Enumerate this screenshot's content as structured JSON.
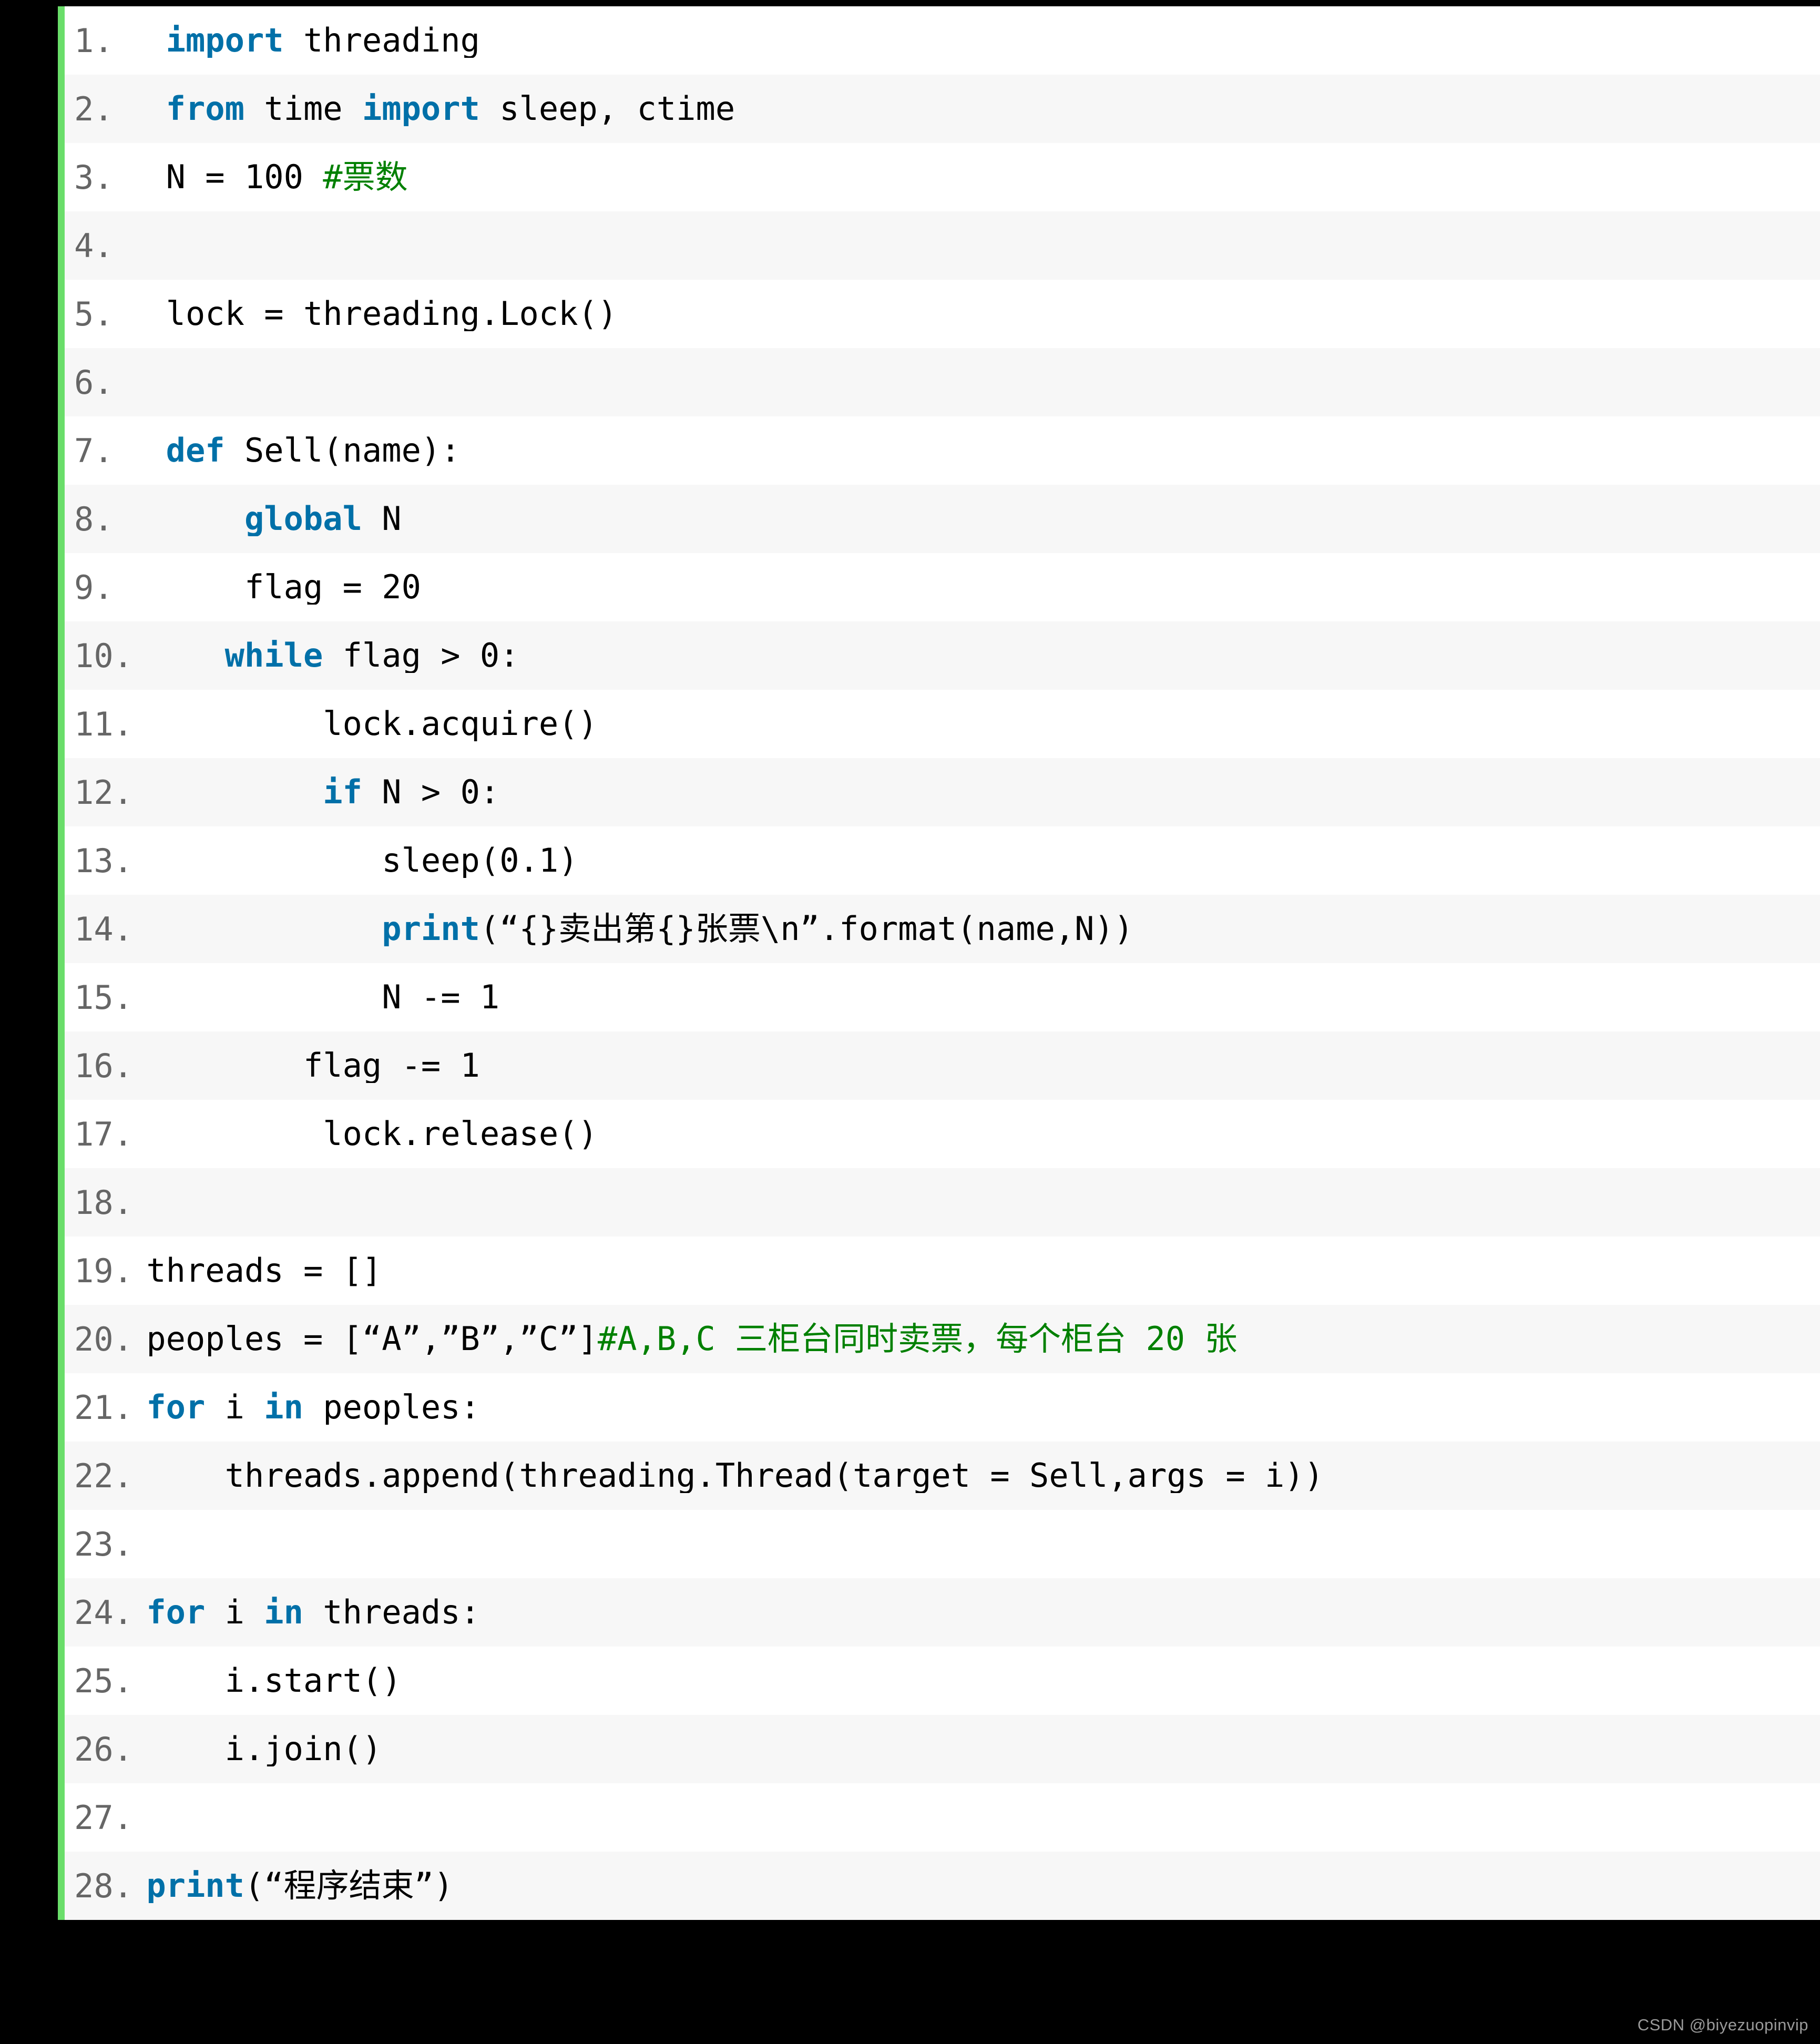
{
  "colors": {
    "page_background": "#000000",
    "code_background": "#ffffff",
    "code_background_alt": "#f7f7f7",
    "accent_bar": "#6ade6a",
    "keyword": "#0070a8",
    "comment": "#008000",
    "line_number": "#666666",
    "code_text": "#000000",
    "watermark": "#9a9a9a"
  },
  "code_block": {
    "language": "python",
    "lines": [
      {
        "n": "1.",
        "segments": [
          {
            "t": "  ",
            "c": "plain"
          },
          {
            "t": "import",
            "c": "kw"
          },
          {
            "t": " threading",
            "c": "plain"
          }
        ]
      },
      {
        "n": "2.",
        "segments": [
          {
            "t": "  ",
            "c": "plain"
          },
          {
            "t": "from",
            "c": "kw"
          },
          {
            "t": " time ",
            "c": "plain"
          },
          {
            "t": "import",
            "c": "kw"
          },
          {
            "t": " sleep, ctime",
            "c": "plain"
          }
        ]
      },
      {
        "n": "3.",
        "segments": [
          {
            "t": "  N = 100 ",
            "c": "plain"
          },
          {
            "t": "#票数",
            "c": "cmt"
          }
        ]
      },
      {
        "n": "4.",
        "segments": []
      },
      {
        "n": "5.",
        "segments": [
          {
            "t": "  lock = threading.Lock()",
            "c": "plain"
          }
        ]
      },
      {
        "n": "6.",
        "segments": []
      },
      {
        "n": "7.",
        "segments": [
          {
            "t": "  ",
            "c": "plain"
          },
          {
            "t": "def",
            "c": "kw"
          },
          {
            "t": " Sell(name):",
            "c": "plain"
          }
        ]
      },
      {
        "n": "8.",
        "segments": [
          {
            "t": "      ",
            "c": "plain"
          },
          {
            "t": "global",
            "c": "kw"
          },
          {
            "t": " N",
            "c": "plain"
          }
        ]
      },
      {
        "n": "9.",
        "segments": [
          {
            "t": "      flag = 20",
            "c": "plain"
          }
        ]
      },
      {
        "n": "10.",
        "segments": [
          {
            "t": "     ",
            "c": "plain"
          },
          {
            "t": "while",
            "c": "kw"
          },
          {
            "t": " flag > 0:",
            "c": "plain"
          }
        ]
      },
      {
        "n": "11.",
        "segments": [
          {
            "t": "          lock.acquire()",
            "c": "plain"
          }
        ]
      },
      {
        "n": "12.",
        "segments": [
          {
            "t": "          ",
            "c": "plain"
          },
          {
            "t": "if",
            "c": "kw"
          },
          {
            "t": " N > 0:",
            "c": "plain"
          }
        ]
      },
      {
        "n": "13.",
        "segments": [
          {
            "t": "             sleep(0.1)",
            "c": "plain"
          }
        ]
      },
      {
        "n": "14.",
        "segments": [
          {
            "t": "             ",
            "c": "plain"
          },
          {
            "t": "print",
            "c": "kw"
          },
          {
            "t": "(“{}卖出第{}张票\\n”.format(name,N))",
            "c": "plain"
          }
        ]
      },
      {
        "n": "15.",
        "segments": [
          {
            "t": "             N -= 1",
            "c": "plain"
          }
        ]
      },
      {
        "n": "16.",
        "segments": [
          {
            "t": "         flag -= 1",
            "c": "plain"
          }
        ]
      },
      {
        "n": "17.",
        "segments": [
          {
            "t": "          lock.release()",
            "c": "plain"
          }
        ]
      },
      {
        "n": "18.",
        "segments": []
      },
      {
        "n": "19.",
        "segments": [
          {
            "t": " threads = []",
            "c": "plain"
          }
        ]
      },
      {
        "n": "20.",
        "segments": [
          {
            "t": " peoples = [“A”,”B”,”C”]",
            "c": "plain"
          },
          {
            "t": "#A,B,C 三柜台同时卖票，每个柜台 20 张",
            "c": "cmt"
          }
        ]
      },
      {
        "n": "21.",
        "segments": [
          {
            "t": " ",
            "c": "plain"
          },
          {
            "t": "for",
            "c": "kw"
          },
          {
            "t": " i ",
            "c": "plain"
          },
          {
            "t": "in",
            "c": "kw"
          },
          {
            "t": " peoples:",
            "c": "plain"
          }
        ]
      },
      {
        "n": "22.",
        "segments": [
          {
            "t": "     threads.append(threading.Thread(target = Sell,args = i))",
            "c": "plain"
          }
        ]
      },
      {
        "n": "23.",
        "segments": []
      },
      {
        "n": "24.",
        "segments": [
          {
            "t": " ",
            "c": "plain"
          },
          {
            "t": "for",
            "c": "kw"
          },
          {
            "t": " i ",
            "c": "plain"
          },
          {
            "t": "in",
            "c": "kw"
          },
          {
            "t": " threads:",
            "c": "plain"
          }
        ]
      },
      {
        "n": "25.",
        "segments": [
          {
            "t": "     i.start()",
            "c": "plain"
          }
        ]
      },
      {
        "n": "26.",
        "segments": [
          {
            "t": "     i.join()",
            "c": "plain"
          }
        ]
      },
      {
        "n": "27.",
        "segments": []
      },
      {
        "n": "28.",
        "segments": [
          {
            "t": " ",
            "c": "plain"
          },
          {
            "t": "print",
            "c": "kw"
          },
          {
            "t": "(“程序结束”)",
            "c": "plain"
          }
        ]
      }
    ]
  },
  "watermark": {
    "text": "CSDN @biyezuopinvip"
  }
}
